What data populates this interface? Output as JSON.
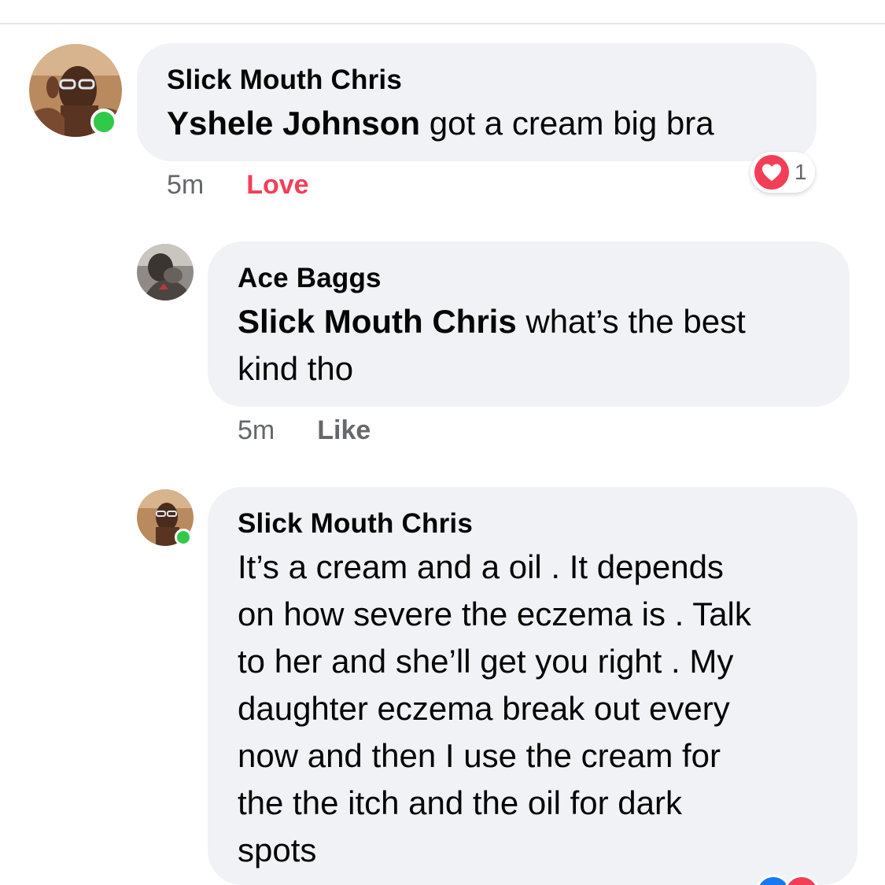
{
  "comments": [
    {
      "author": "Slick Mouth Chris",
      "mention": "Yshele Johnson",
      "text": " got a cream big bra",
      "time": "5m",
      "action": "Love",
      "reaction_count": "1",
      "reaction_icon": "heart-icon",
      "online": true
    },
    {
      "author": "Ace Baggs",
      "mention": "Slick Mouth Chris",
      "text_line1": " what’s the best",
      "text_line2": "kind tho",
      "time": "5m",
      "action": "Like",
      "online": false
    },
    {
      "author": "Slick Mouth Chris",
      "lines": [
        "It’s a cream and a oil . It depends",
        "on how severe the eczema is . Talk",
        "to her and she’ll get you right . My",
        "daughter eczema break out every",
        "now and then I use the cream for",
        "the the itch and the oil for dark",
        "spots"
      ],
      "online": true
    }
  ],
  "colors": {
    "bubble": "#f0f2f5",
    "love": "#f33e58",
    "meta_text": "#65676b",
    "online": "#31c94a"
  }
}
